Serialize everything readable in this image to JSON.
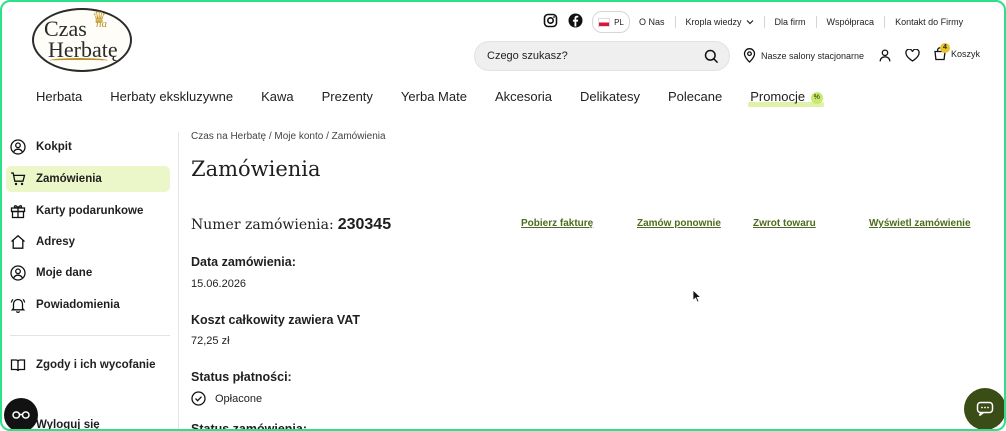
{
  "logo": {
    "line1": "Czas",
    "line2": "na",
    "line3": "Herbatę"
  },
  "topbar": {
    "lang": "PL",
    "links": [
      "O Nas",
      "Kropla wiedzy",
      "Dla firm",
      "Współpraca",
      "Kontakt do Firmy"
    ]
  },
  "search": {
    "placeholder": "Czego szukasz?"
  },
  "shop": {
    "stores": "Nasze salony stacjonarne",
    "cart_label": "Koszyk",
    "cart_count": "4"
  },
  "nav": [
    "Herbata",
    "Herbaty ekskluzywne",
    "Kawa",
    "Prezenty",
    "Yerba Mate",
    "Akcesoria",
    "Delikatesy",
    "Polecane",
    "Promocje"
  ],
  "promo_badge": "%",
  "sidebar": {
    "items": [
      "Kokpit",
      "Zamówienia",
      "Karty podarunkowe",
      "Adresy",
      "Moje dane",
      "Powiadomienia"
    ],
    "consents": "Zgody i ich wycofanie",
    "logout": "Wyloguj się"
  },
  "breadcrumb": {
    "home": "Czas na Herbatę",
    "sep": " / ",
    "account": "Moje konto",
    "current": "Zamówienia"
  },
  "page_title": "Zamówienia",
  "order": {
    "number_label": "Numer zamówienia:",
    "number": "230345",
    "actions": [
      "Pobierz fakturę",
      "Zamów ponownie",
      "Zwrot towaru",
      "Wyświetl zamówienie"
    ],
    "date_label": "Data zamówienia:",
    "date": "15.06.2026",
    "total_label": "Koszt całkowity zawiera VAT",
    "total": "72,25 zł",
    "payment_label": "Status płatności:",
    "payment_status": "Opłacone",
    "next_label": "Status zamówienia:"
  },
  "colors": {
    "accent": "#4e6b1e",
    "active_bg": "#ecf7c9",
    "chat": "#3a4d16",
    "frame": "#2ee08a"
  }
}
